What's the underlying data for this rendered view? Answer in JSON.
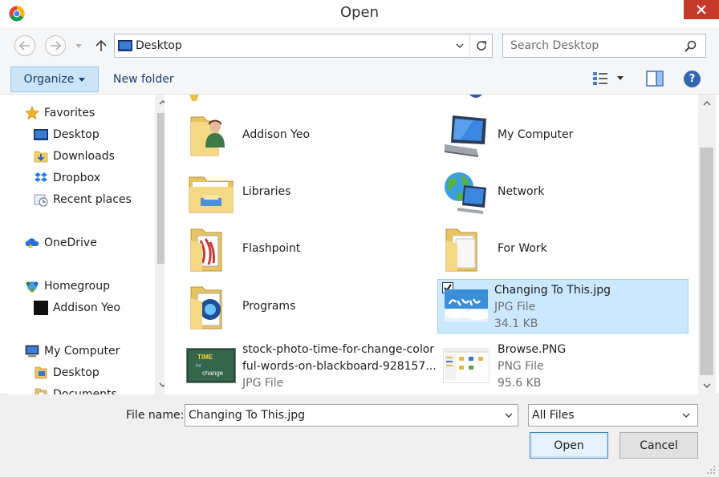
{
  "window": {
    "title": "Open"
  },
  "navigation": {
    "address": "Desktop",
    "search_placeholder": "Search Desktop"
  },
  "toolbar": {
    "organize_label": "Organize",
    "new_folder_label": "New folder"
  },
  "sidebar": {
    "items": [
      {
        "label": "Favorites",
        "icon": "star-icon",
        "indent": 0
      },
      {
        "label": "Desktop",
        "icon": "desktop-icon",
        "indent": 1
      },
      {
        "label": "Downloads",
        "icon": "downloads-icon",
        "indent": 1
      },
      {
        "label": "Dropbox",
        "icon": "dropbox-icon",
        "indent": 1
      },
      {
        "label": "Recent places",
        "icon": "recent-places-icon",
        "indent": 1
      },
      {
        "label": "OneDrive",
        "icon": "onedrive-icon",
        "indent": 0
      },
      {
        "label": "Homegroup",
        "icon": "homegroup-icon",
        "indent": 0
      },
      {
        "label": "Addison Yeo",
        "icon": "user-icon",
        "indent": 1
      },
      {
        "label": "My Computer",
        "icon": "computer-icon",
        "indent": 0
      },
      {
        "label": "Desktop",
        "icon": "desktop-folder-icon",
        "indent": 1
      },
      {
        "label": "Documents",
        "icon": "documents-icon",
        "indent": 1
      }
    ]
  },
  "files": [
    {
      "name": "Addison Yeo",
      "icon": "user-folder-icon"
    },
    {
      "name": "My Computer",
      "icon": "computer-icon"
    },
    {
      "name": "Libraries",
      "icon": "libraries-icon"
    },
    {
      "name": "Network",
      "icon": "network-icon"
    },
    {
      "name": "Flashpoint",
      "icon": "folder-icon"
    },
    {
      "name": "For Work",
      "icon": "folder-icon"
    },
    {
      "name": "Programs",
      "icon": "folder-icon"
    },
    {
      "name": "Changing To This.jpg",
      "type": "JPG File",
      "size": "34.1 KB",
      "icon": "image-thumbnail-icon",
      "selected": true
    },
    {
      "name_line1": "stock-photo-time-for-change-color",
      "name_line2": "ful-words-on-blackboard-928157...",
      "type": "JPG File",
      "icon": "image-thumbnail-icon"
    },
    {
      "name": "Browse.PNG",
      "type": "PNG File",
      "size": "95.6 KB",
      "icon": "image-thumbnail-icon"
    }
  ],
  "footer": {
    "filename_label": "File name:",
    "filename_value": "Changing To This.jpg",
    "filetype_value": "All Files",
    "open_label": "Open",
    "cancel_label": "Cancel"
  },
  "colors": {
    "selection_bg": "#cce8ff",
    "selection_border": "#99d1ff",
    "close_button": "#c7392b",
    "organize_bg": "#cce4f7"
  }
}
